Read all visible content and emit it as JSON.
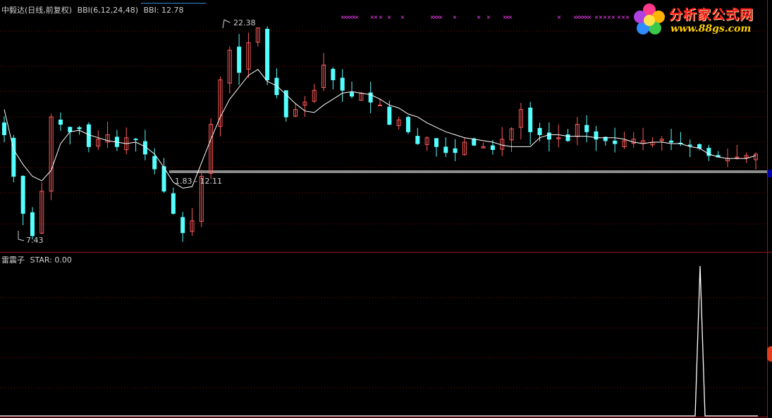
{
  "top_panel": {
    "name": "中毅达(日线,前复权)",
    "indicator": "BBI(6,12,24,48)",
    "indicator_value_label": "BBI: 12.78",
    "high_label": "22.38",
    "low_label": "7.43",
    "range_label": "1.83 - 12.11"
  },
  "bottom_panel": {
    "name": "雷震子",
    "value_label": "STAR: 0.00"
  },
  "watermark": {
    "title": "分析家公式网",
    "url": "www.88gs.com"
  },
  "colors": {
    "up": "#ff5a5a",
    "down": "#54ffff",
    "bbi": "#ffffff",
    "grid": "#7a1010",
    "border": "#a01414",
    "marks": "#ff44ff",
    "band": "#8c8c8c"
  },
  "chart_data": [
    {
      "type": "candlestick",
      "title": "中毅达(日线,前复权)",
      "ylim": [
        7.0,
        23.5
      ],
      "annotations": [
        "22.38",
        "7.43",
        "1.83 - 12.11"
      ],
      "series": [
        {
          "name": "BBI",
          "last_value": 12.78,
          "values": [
            16.5,
            13.8,
            12.8,
            12.0,
            11.7,
            12.4,
            14.2,
            15.0,
            15.1,
            14.8,
            14.6,
            14.4,
            14.3,
            14.2,
            14.3,
            14.0,
            13.5,
            12.6,
            11.6,
            11.2,
            11.3,
            12.9,
            14.5,
            16.0,
            17.2,
            18.0,
            18.8,
            19.2,
            18.4,
            18.1,
            17.5,
            16.9,
            16.4,
            16.3,
            16.8,
            17.2,
            17.6,
            17.7,
            17.6,
            17.5,
            17.2,
            16.8,
            16.6,
            16.2,
            16.0,
            15.6,
            15.3,
            15.0,
            14.8,
            14.6,
            14.5,
            14.4,
            14.3,
            14.1,
            14.0,
            14.0,
            14.0,
            14.6,
            14.8,
            14.8,
            14.7,
            14.7,
            14.7,
            14.6,
            14.6,
            14.6,
            14.5,
            14.3,
            14.2,
            14.3,
            14.3,
            14.2,
            14.2,
            14.0,
            13.9,
            13.5,
            13.3,
            13.2,
            13.2,
            13.2,
            13.4
          ]
        }
      ]
    },
    {
      "type": "line",
      "title": "雷震子",
      "series": [
        {
          "name": "STAR",
          "last_value": 0.0,
          "spike_value": 1
        }
      ]
    }
  ]
}
